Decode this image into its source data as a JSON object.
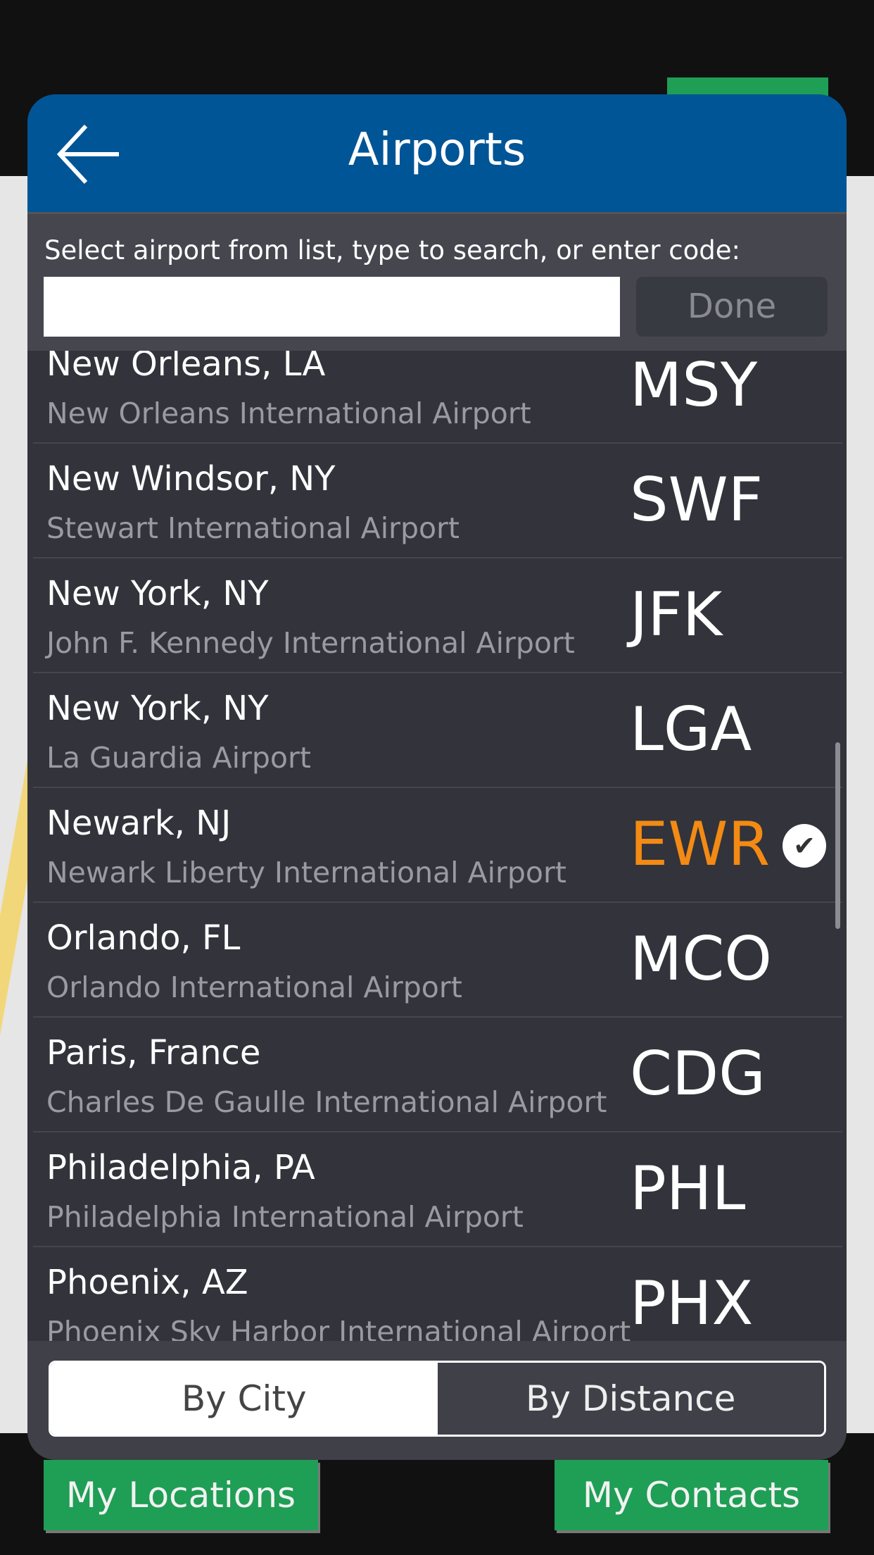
{
  "header": {
    "title": "Airports",
    "back_icon": "arrow-left-icon"
  },
  "search": {
    "instruction": "Select airport from list, type to search, or enter code:",
    "value": "",
    "placeholder": "",
    "done_label": "Done"
  },
  "airports": [
    {
      "city": "New Orleans, LA",
      "name": "New Orleans International Airport",
      "code": "MSY",
      "selected": false
    },
    {
      "city": "New Windsor, NY",
      "name": "Stewart International Airport",
      "code": "SWF",
      "selected": false
    },
    {
      "city": "New York, NY",
      "name": "John F. Kennedy International Airport",
      "code": "JFK",
      "selected": false
    },
    {
      "city": "New York, NY",
      "name": "La Guardia Airport",
      "code": "LGA",
      "selected": false
    },
    {
      "city": "Newark, NJ",
      "name": "Newark Liberty International Airport",
      "code": "EWR",
      "selected": true
    },
    {
      "city": "Orlando, FL",
      "name": "Orlando International Airport",
      "code": "MCO",
      "selected": false
    },
    {
      "city": "Paris, France",
      "name": "Charles De Gaulle International Airport",
      "code": "CDG",
      "selected": false
    },
    {
      "city": "Philadelphia, PA",
      "name": "Philadelphia International Airport",
      "code": "PHL",
      "selected": false
    },
    {
      "city": "Phoenix, AZ",
      "name": "Phoenix Sky Harbor International Airport",
      "code": "PHX",
      "selected": false
    }
  ],
  "sort": {
    "options": [
      "By City",
      "By Distance"
    ],
    "selected": "By City"
  },
  "bottom": {
    "locations_label": "My Locations",
    "contacts_label": "My Contacts"
  },
  "colors": {
    "header": "#005596",
    "selected_code": "#f28a14",
    "button_green": "#1f9e55",
    "modal_bg": "#3f4048"
  }
}
